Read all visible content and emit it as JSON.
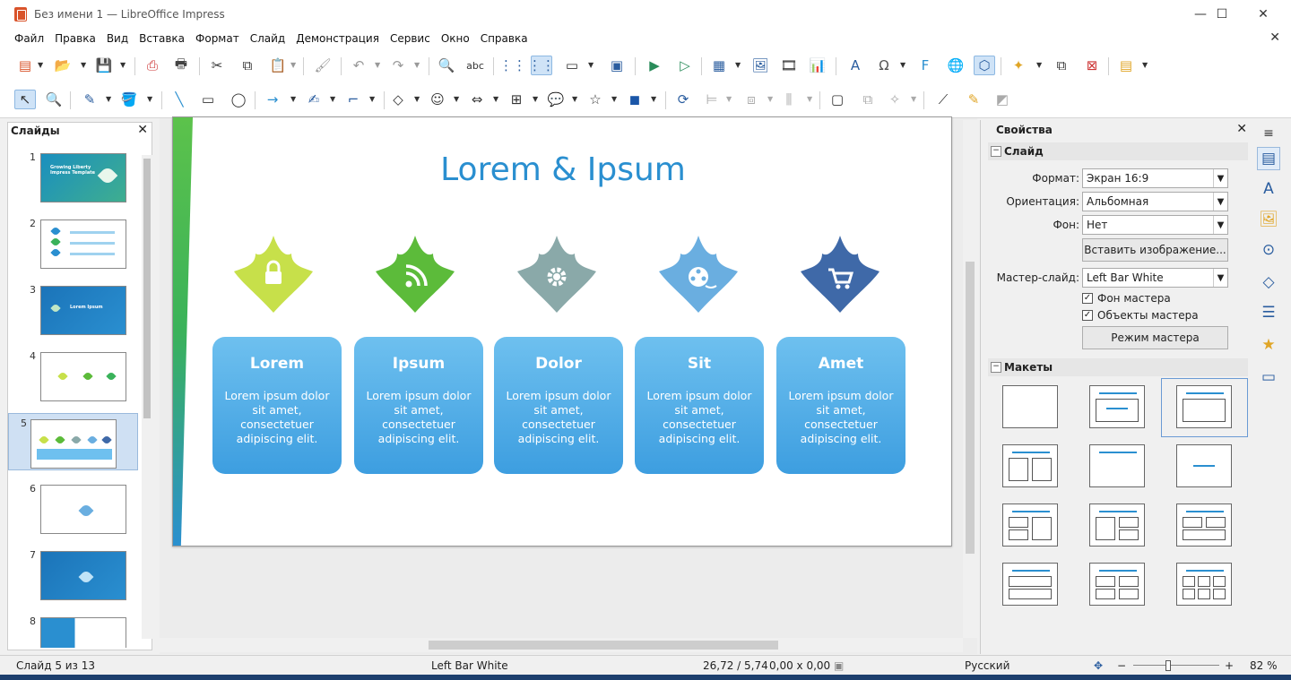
{
  "window": {
    "title": "Без имени 1 — LibreOffice Impress"
  },
  "menu": [
    "Файл",
    "Правка",
    "Вид",
    "Вставка",
    "Формат",
    "Слайд",
    "Демонстрация",
    "Сервис",
    "Окно",
    "Справка"
  ],
  "slides_panel": {
    "title": "Слайды",
    "thumbs": [
      {
        "num": "1",
        "text": "Growing Liberty Impress Template"
      },
      {
        "num": "2",
        "text": ""
      },
      {
        "num": "3",
        "text": "Lorem Ipsum"
      },
      {
        "num": "4",
        "text": ""
      },
      {
        "num": "5",
        "text": ""
      },
      {
        "num": "6",
        "text": ""
      },
      {
        "num": "7",
        "text": ""
      },
      {
        "num": "8",
        "text": ""
      }
    ]
  },
  "slide": {
    "title": "Lorem & Ipsum",
    "cards": [
      {
        "title": "Lorem",
        "body": "Lorem ipsum dolor sit amet, consectetuer adipiscing elit.",
        "leaf_color": "#c7e04a",
        "icon": "lock-icon"
      },
      {
        "title": "Ipsum",
        "body": "Lorem ipsum dolor sit amet, consectetuer adipiscing elit.",
        "leaf_color": "#5cbb3a",
        "icon": "rss-icon"
      },
      {
        "title": "Dolor",
        "body": "Lorem ipsum dolor sit amet, consectetuer adipiscing elit.",
        "leaf_color": "#8aa9a9",
        "icon": "gear-icon"
      },
      {
        "title": "Sit",
        "body": "Lorem ipsum dolor sit amet, consectetuer adipiscing elit.",
        "leaf_color": "#6aaee0",
        "icon": "film-reel-icon"
      },
      {
        "title": "Amet",
        "body": "Lorem ipsum dolor sit amet, consectetuer adipiscing elit.",
        "leaf_color": "#3f69a8",
        "icon": "cart-icon"
      }
    ]
  },
  "properties": {
    "title": "Свойства",
    "slide_section": "Слайд",
    "format_label": "Формат:",
    "format_value": "Экран 16:9",
    "orientation_label": "Ориентация:",
    "orientation_value": "Альбомная",
    "background_label": "Фон:",
    "background_value": "Нет",
    "insert_image_button": "Вставить изображение...",
    "master_label": "Мастер-слайд:",
    "master_value": "Left Bar White",
    "master_bg_check": "Фон мастера",
    "master_objects_check": "Объекты мастера",
    "master_mode_button": "Режим мастера",
    "layouts_section": "Макеты"
  },
  "status": {
    "slide_pos": "Слайд 5 из 13",
    "master": "Left Bar White",
    "coords": "26,72 / 5,74",
    "size": "0,00 x 0,00",
    "language": "Русский",
    "zoom": "82 %"
  },
  "colors": {
    "accent": "#2a8fd0",
    "card_top": "#6ec0ef",
    "card_bottom": "#3d9ee0"
  }
}
